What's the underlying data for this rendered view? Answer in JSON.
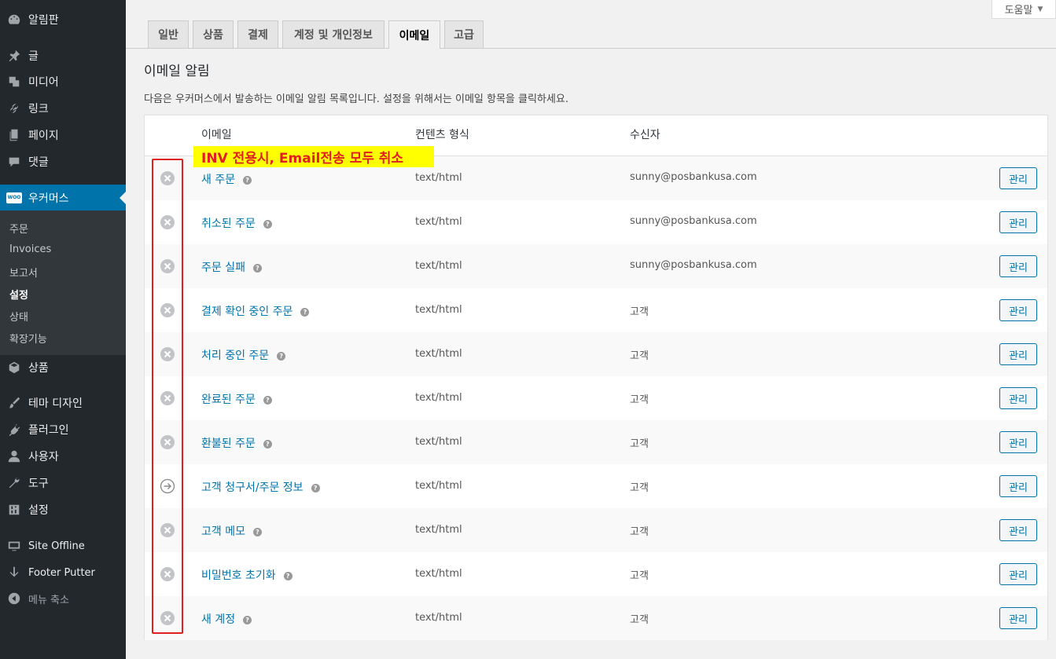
{
  "help": {
    "label": "도움말"
  },
  "sidebar": {
    "items": [
      {
        "label": "알림판",
        "icon": "dashboard-icon"
      },
      {
        "label": "글",
        "icon": "pin-icon"
      },
      {
        "label": "미디어",
        "icon": "media-icon"
      },
      {
        "label": "링크",
        "icon": "link-icon"
      },
      {
        "label": "페이지",
        "icon": "page-icon"
      },
      {
        "label": "댓글",
        "icon": "comment-icon"
      },
      {
        "label": "우커머스",
        "icon": "woo-icon"
      },
      {
        "label": "상품",
        "icon": "box-icon"
      },
      {
        "label": "테마 디자인",
        "icon": "brush-icon"
      },
      {
        "label": "플러그인",
        "icon": "plug-icon"
      },
      {
        "label": "사용자",
        "icon": "user-icon"
      },
      {
        "label": "도구",
        "icon": "wrench-icon"
      },
      {
        "label": "설정",
        "icon": "settings-icon"
      },
      {
        "label": "Site Offline",
        "icon": "eye-icon"
      },
      {
        "label": "Footer Putter",
        "icon": "arrow-down-icon"
      },
      {
        "label": "메뉴 축소",
        "icon": "collapse-icon"
      }
    ],
    "woo_icon_text": "WOO",
    "submenu": [
      "주문",
      "Invoices",
      "보고서",
      "설정",
      "상태",
      "확장기능"
    ]
  },
  "tabs": [
    "일반",
    "상품",
    "결제",
    "계정 및 개인정보",
    "이메일",
    "고급"
  ],
  "page": {
    "title": "이메일 알림",
    "description": "다음은 우커머스에서 발송하는 이메일 알림 목록입니다. 설정을 위해서는 이메일 항목을 클릭하세요."
  },
  "table": {
    "headers": {
      "email": "이메일",
      "content_type": "컨텐츠 형식",
      "recipient": "수신자"
    },
    "manage_label": "관리",
    "help_mark": "?",
    "rows": [
      {
        "name": "새 주문",
        "content_type": "text/html",
        "recipient": "sunny@posbankusa.com",
        "status": "disabled"
      },
      {
        "name": "취소된 주문",
        "content_type": "text/html",
        "recipient": "sunny@posbankusa.com",
        "status": "disabled"
      },
      {
        "name": "주문 실패",
        "content_type": "text/html",
        "recipient": "sunny@posbankusa.com",
        "status": "disabled"
      },
      {
        "name": "결제 확인 중인 주문",
        "content_type": "text/html",
        "recipient": "고객",
        "status": "disabled"
      },
      {
        "name": "처리 중인 주문",
        "content_type": "text/html",
        "recipient": "고객",
        "status": "disabled"
      },
      {
        "name": "완료된 주문",
        "content_type": "text/html",
        "recipient": "고객",
        "status": "disabled"
      },
      {
        "name": "환불된 주문",
        "content_type": "text/html",
        "recipient": "고객",
        "status": "disabled"
      },
      {
        "name": "고객 청구서/주문 정보",
        "content_type": "text/html",
        "recipient": "고객",
        "status": "manual"
      },
      {
        "name": "고객 메모",
        "content_type": "text/html",
        "recipient": "고객",
        "status": "disabled"
      },
      {
        "name": "비밀번호 초기화",
        "content_type": "text/html",
        "recipient": "고객",
        "status": "disabled"
      },
      {
        "name": "새 계정",
        "content_type": "text/html",
        "recipient": "고객",
        "status": "disabled"
      }
    ]
  },
  "annotation": {
    "text": "INV 전용시, Email전송 모두 취소"
  },
  "colors": {
    "accent": "#0073aa",
    "sidebar": "#23282d",
    "annotation_red": "#e02020",
    "annotation_yellow": "#ffff00"
  }
}
